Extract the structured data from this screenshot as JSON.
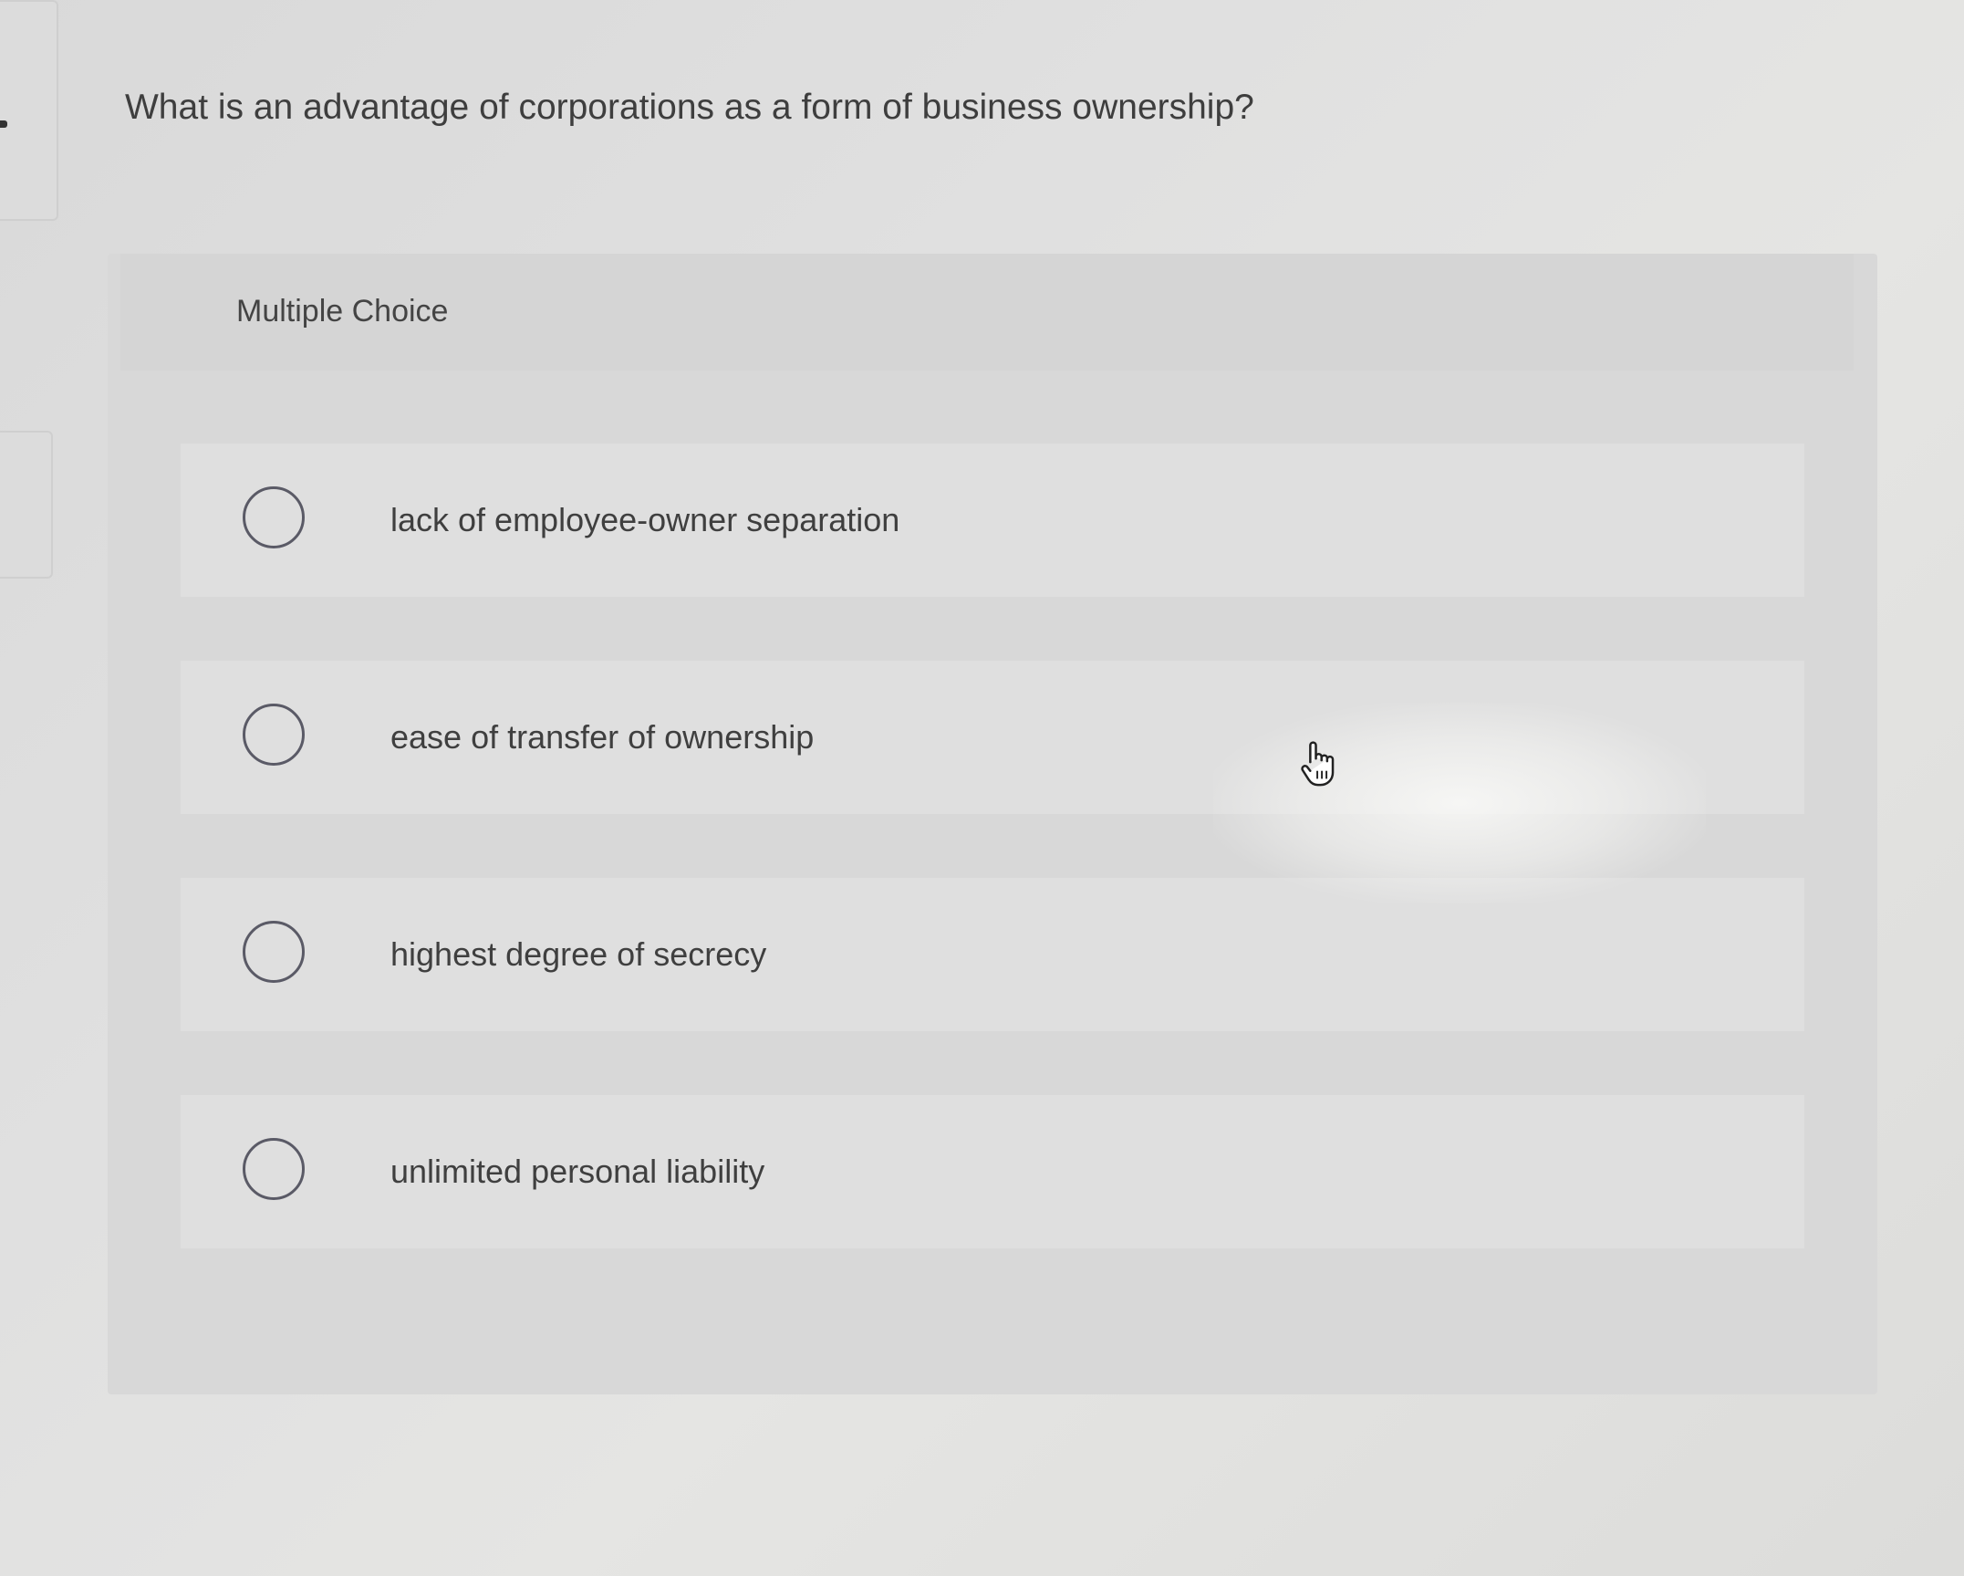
{
  "question": {
    "text": "What is an advantage of corporations as a form of business ownership?"
  },
  "card": {
    "type_label": "Multiple Choice"
  },
  "options": [
    {
      "label": "lack of employee-owner separation",
      "selected": false
    },
    {
      "label": "ease of transfer of ownership",
      "selected": false
    },
    {
      "label": "highest degree of secrecy",
      "selected": false
    },
    {
      "label": "unlimited personal liability",
      "selected": false
    }
  ],
  "cursor": {
    "icon": "hand-pointer-icon"
  }
}
